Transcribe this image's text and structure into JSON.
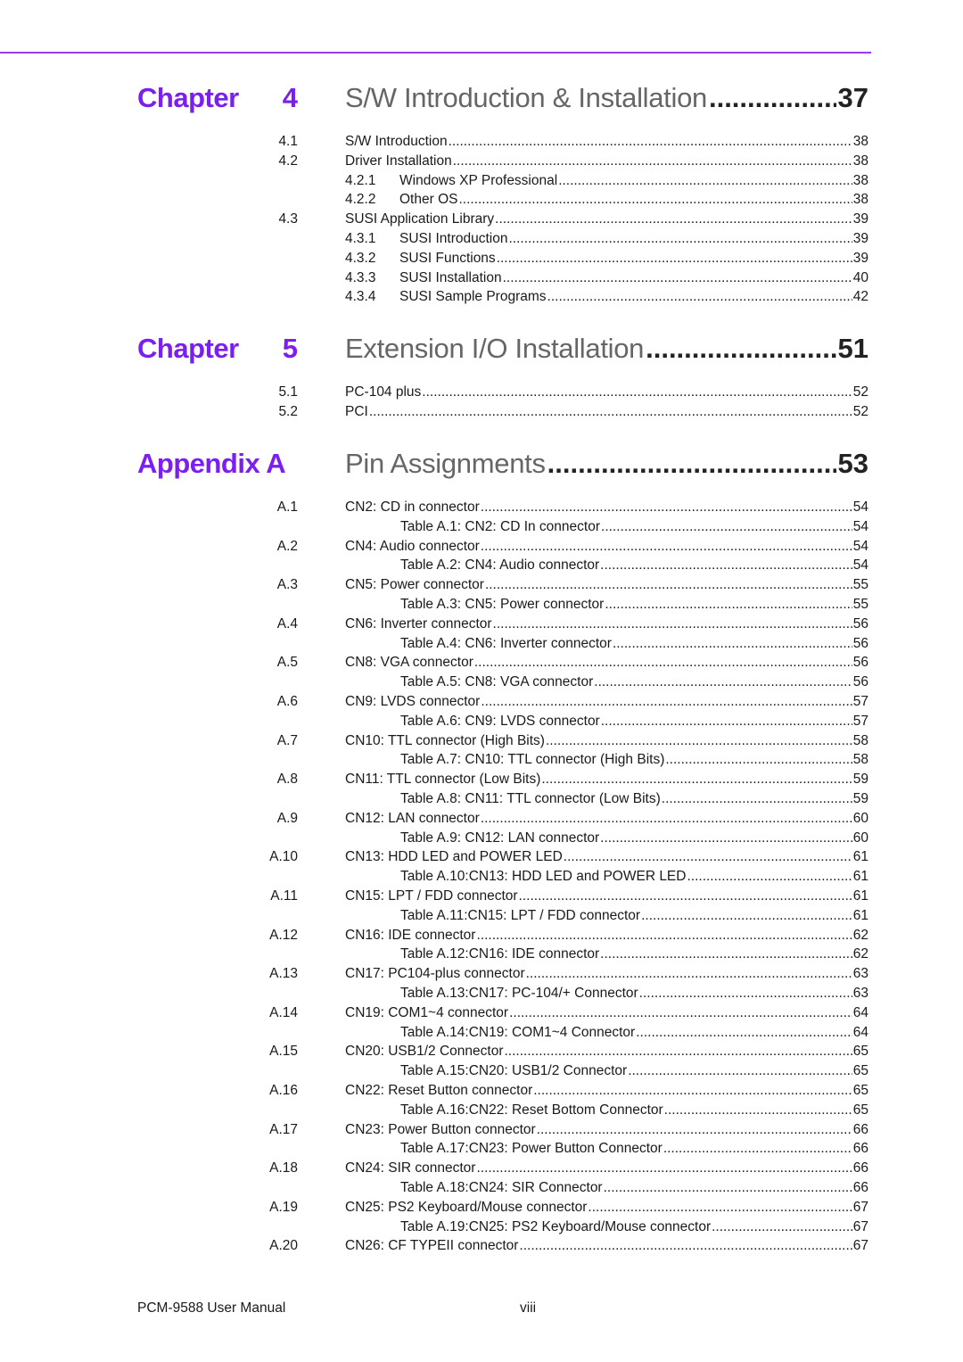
{
  "accent_color": "#7b1ff0",
  "chapters": [
    {
      "label": "Chapter",
      "number": "4",
      "title": "S/W Introduction & Installation",
      "page": "37",
      "entries": [
        {
          "type": "section",
          "num": "4.1",
          "text": "S/W Introduction",
          "page": "38"
        },
        {
          "type": "section",
          "num": "4.2",
          "text": "Driver Installation",
          "page": "38"
        },
        {
          "type": "subsection",
          "num": "4.2.1",
          "text": "Windows XP Professional",
          "page": "38"
        },
        {
          "type": "subsection",
          "num": "4.2.2",
          "text": "Other OS",
          "page": "38"
        },
        {
          "type": "section",
          "num": "4.3",
          "text": "SUSI Application Library",
          "page": "39"
        },
        {
          "type": "subsection",
          "num": "4.3.1",
          "text": "SUSI Introduction",
          "page": "39"
        },
        {
          "type": "subsection",
          "num": "4.3.2",
          "text": "SUSI Functions",
          "page": "39"
        },
        {
          "type": "subsection",
          "num": "4.3.3",
          "text": "SUSI Installation",
          "page": "40"
        },
        {
          "type": "subsection",
          "num": "4.3.4",
          "text": "SUSI Sample Programs",
          "page": "42"
        }
      ]
    },
    {
      "label": "Chapter",
      "number": "5",
      "title": "Extension I/O Installation",
      "page": "51",
      "entries": [
        {
          "type": "section",
          "num": "5.1",
          "text": "PC-104 plus",
          "page": "52"
        },
        {
          "type": "section",
          "num": "5.2",
          "text": "PCI",
          "page": "52"
        }
      ]
    },
    {
      "label": "Appendix A",
      "number": "",
      "title": "Pin Assignments",
      "page": "53",
      "entries": [
        {
          "type": "section",
          "num": "A.1",
          "text": "CN2: CD in connector",
          "page": "54"
        },
        {
          "type": "table",
          "num": "",
          "text": "Table A.1:  CN2: CD In connector",
          "page": "54"
        },
        {
          "type": "section",
          "num": "A.2",
          "text": "CN4: Audio connector",
          "page": "54"
        },
        {
          "type": "table",
          "num": "",
          "text": "Table A.2:  CN4: Audio connector",
          "page": "54"
        },
        {
          "type": "section",
          "num": "A.3",
          "text": "CN5: Power connector",
          "page": "55"
        },
        {
          "type": "table",
          "num": "",
          "text": "Table A.3:  CN5: Power connector",
          "page": "55"
        },
        {
          "type": "section",
          "num": "A.4",
          "text": "CN6: Inverter connector",
          "page": "56"
        },
        {
          "type": "table",
          "num": "",
          "text": "Table A.4:  CN6: Inverter connector",
          "page": "56"
        },
        {
          "type": "section",
          "num": "A.5",
          "text": "CN8: VGA connector",
          "page": "56"
        },
        {
          "type": "table",
          "num": "",
          "text": "Table A.5:  CN8: VGA connector",
          "page": "56"
        },
        {
          "type": "section",
          "num": "A.6",
          "text": "CN9: LVDS connector",
          "page": "57"
        },
        {
          "type": "table",
          "num": "",
          "text": "Table A.6:  CN9: LVDS connector",
          "page": "57"
        },
        {
          "type": "section",
          "num": "A.7",
          "text": "CN10: TTL connector (High Bits)",
          "page": "58"
        },
        {
          "type": "table",
          "num": "",
          "text": "Table A.7:  CN10: TTL connector (High Bits)",
          "page": "58"
        },
        {
          "type": "section",
          "num": "A.8",
          "text": "CN11: TTL connector (Low Bits)",
          "page": "59"
        },
        {
          "type": "table",
          "num": "",
          "text": "Table A.8:  CN11: TTL connector (Low Bits)",
          "page": "59"
        },
        {
          "type": "section",
          "num": "A.9",
          "text": "CN12: LAN connector",
          "page": "60"
        },
        {
          "type": "table",
          "num": "",
          "text": "Table A.9:  CN12: LAN connector",
          "page": "60"
        },
        {
          "type": "section",
          "num": "A.10",
          "text": "CN13: HDD LED and POWER LED",
          "page": "61"
        },
        {
          "type": "table",
          "num": "",
          "text": "Table A.10:CN13: HDD LED and POWER LED",
          "page": "61"
        },
        {
          "type": "section",
          "num": "A.11",
          "text": "CN15: LPT / FDD connector",
          "page": "61"
        },
        {
          "type": "table",
          "num": "",
          "text": "Table A.11:CN15: LPT / FDD connector",
          "page": "61"
        },
        {
          "type": "section",
          "num": "A.12",
          "text": "CN16: IDE connector",
          "page": "62"
        },
        {
          "type": "table",
          "num": "",
          "text": "Table A.12:CN16: IDE connector",
          "page": "62"
        },
        {
          "type": "section",
          "num": "A.13",
          "text": "CN17: PC104-plus connector",
          "page": "63"
        },
        {
          "type": "table",
          "num": "",
          "text": "Table A.13:CN17: PC-104/+ Connector",
          "page": "63"
        },
        {
          "type": "section",
          "num": "A.14",
          "text": "CN19: COM1~4 connector",
          "page": "64"
        },
        {
          "type": "table",
          "num": "",
          "text": "Table A.14:CN19: COM1~4 Connector",
          "page": "64"
        },
        {
          "type": "section",
          "num": "A.15",
          "text": "CN20: USB1/2 Connector",
          "page": "65"
        },
        {
          "type": "table",
          "num": "",
          "text": "Table A.15:CN20: USB1/2 Connector",
          "page": "65"
        },
        {
          "type": "section",
          "num": "A.16",
          "text": "CN22: Reset Button connector",
          "page": "65"
        },
        {
          "type": "table",
          "num": "",
          "text": "Table A.16:CN22: Reset Bottom Connector",
          "page": "65"
        },
        {
          "type": "section",
          "num": "A.17",
          "text": "CN23: Power Button connector",
          "page": "66"
        },
        {
          "type": "table",
          "num": "",
          "text": "Table A.17:CN23: Power Button Connector",
          "page": "66"
        },
        {
          "type": "section",
          "num": "A.18",
          "text": "CN24: SIR connector",
          "page": "66"
        },
        {
          "type": "table",
          "num": "",
          "text": "Table A.18:CN24: SIR Connector",
          "page": "66"
        },
        {
          "type": "section",
          "num": "A.19",
          "text": "CN25: PS2 Keyboard/Mouse connector",
          "page": "67"
        },
        {
          "type": "table",
          "num": "",
          "text": "Table A.19:CN25: PS2 Keyboard/Mouse connector",
          "page": "67"
        },
        {
          "type": "section",
          "num": "A.20",
          "text": "CN26: CF TYPEII connector",
          "page": "67"
        }
      ]
    }
  ],
  "footer": {
    "manual_title": "PCM-9588 User Manual",
    "page_number": "viii"
  }
}
